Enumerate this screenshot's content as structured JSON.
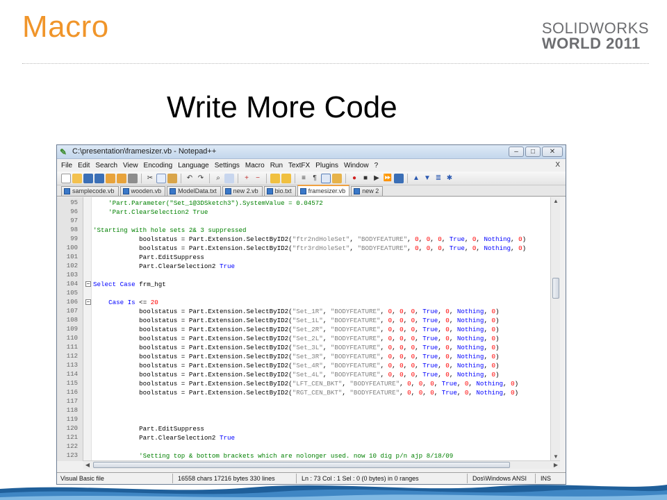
{
  "slide": {
    "title": "Macro",
    "brand_line1": "SOLIDWORKS",
    "brand_line2": "WORLD 2011",
    "heading": "Write More Code"
  },
  "window": {
    "title": "C:\\presentation\\framesizer.vb - Notepad++",
    "buttons": {
      "minimize": "–",
      "maximize": "□",
      "close": "✕"
    }
  },
  "menu": {
    "items": [
      "File",
      "Edit",
      "Search",
      "View",
      "Encoding",
      "Language",
      "Settings",
      "Macro",
      "Run",
      "TextFX",
      "Plugins",
      "Window",
      "?"
    ],
    "close_x": "X"
  },
  "tabs": [
    {
      "label": "samplecode.vb",
      "active": false
    },
    {
      "label": "wooden.vb",
      "active": false
    },
    {
      "label": "ModelData.txt",
      "active": false
    },
    {
      "label": "new 2.vb",
      "active": false
    },
    {
      "label": "bio.txt",
      "active": false
    },
    {
      "label": "framesizer.vb",
      "active": true
    },
    {
      "label": "new 2",
      "active": false
    }
  ],
  "editor": {
    "lines": [
      {
        "n": "95",
        "code": "    'Part.Parameter(\"Set_1@3DSketch3\").SystemValue = 0.04572",
        "type": "comment",
        "fold": ""
      },
      {
        "n": "96",
        "code": "    'Part.ClearSelection2 True",
        "type": "comment",
        "fold": ""
      },
      {
        "n": "97",
        "code": "",
        "type": "plain",
        "fold": ""
      },
      {
        "n": "98",
        "code": "'Starting with hole sets 2& 3 suppressed",
        "type": "comment",
        "fold": ""
      },
      {
        "n": "99",
        "code": "            boolstatus = Part.Extension.SelectByID2(\"ftr2ndHoleSet\", \"BODYFEATURE\", 0, 0, 0, True, 0, Nothing, 0)",
        "type": "call",
        "fold": ""
      },
      {
        "n": "100",
        "code": "            boolstatus = Part.Extension.SelectByID2(\"ftr3rdHoleSet\", \"BODYFEATURE\", 0, 0, 0, True, 0, Nothing, 0)",
        "type": "call",
        "fold": ""
      },
      {
        "n": "101",
        "code": "            Part.EditSuppress",
        "type": "plain",
        "fold": ""
      },
      {
        "n": "102",
        "code": "            Part.ClearSelection2 True",
        "type": "true",
        "fold": ""
      },
      {
        "n": "103",
        "code": "",
        "type": "plain",
        "fold": ""
      },
      {
        "n": "104",
        "code": "Select Case frm_hgt",
        "type": "select",
        "fold": "−"
      },
      {
        "n": "105",
        "code": "",
        "type": "plain",
        "fold": ""
      },
      {
        "n": "106",
        "code": "    Case Is <= 20",
        "type": "case",
        "fold": "−"
      },
      {
        "n": "107",
        "code": "            boolstatus = Part.Extension.SelectByID2(\"Set_1R\", \"BODYFEATURE\", 0, 0, 0, True, 0, Nothing, 0)",
        "type": "call",
        "fold": ""
      },
      {
        "n": "108",
        "code": "            boolstatus = Part.Extension.SelectByID2(\"Set_1L\", \"BODYFEATURE\", 0, 0, 0, True, 0, Nothing, 0)",
        "type": "call",
        "fold": ""
      },
      {
        "n": "109",
        "code": "            boolstatus = Part.Extension.SelectByID2(\"Set_2R\", \"BODYFEATURE\", 0, 0, 0, True, 0, Nothing, 0)",
        "type": "call",
        "fold": ""
      },
      {
        "n": "110",
        "code": "            boolstatus = Part.Extension.SelectByID2(\"Set_2L\", \"BODYFEATURE\", 0, 0, 0, True, 0, Nothing, 0)",
        "type": "call",
        "fold": ""
      },
      {
        "n": "111",
        "code": "            boolstatus = Part.Extension.SelectByID2(\"Set_3L\", \"BODYFEATURE\", 0, 0, 0, True, 0, Nothing, 0)",
        "type": "call",
        "fold": ""
      },
      {
        "n": "112",
        "code": "            boolstatus = Part.Extension.SelectByID2(\"Set_3R\", \"BODYFEATURE\", 0, 0, 0, True, 0, Nothing, 0)",
        "type": "call",
        "fold": ""
      },
      {
        "n": "113",
        "code": "            boolstatus = Part.Extension.SelectByID2(\"Set_4R\", \"BODYFEATURE\", 0, 0, 0, True, 0, Nothing, 0)",
        "type": "call",
        "fold": ""
      },
      {
        "n": "114",
        "code": "            boolstatus = Part.Extension.SelectByID2(\"Set_4L\", \"BODYFEATURE\", 0, 0, 0, True, 0, Nothing, 0)",
        "type": "call",
        "fold": ""
      },
      {
        "n": "115",
        "code": "            boolstatus = Part.Extension.SelectByID2(\"LFT_CEN_BKT\", \"BODYFEATURE\", 0, 0, 0, True, 0, Nothing, 0)",
        "type": "call",
        "fold": ""
      },
      {
        "n": "116",
        "code": "            boolstatus = Part.Extension.SelectByID2(\"RGT_CEN_BKT\", \"BODYFEATURE\", 0, 0, 0, True, 0, Nothing, 0)",
        "type": "call",
        "fold": ""
      },
      {
        "n": "117",
        "code": "",
        "type": "plain",
        "fold": ""
      },
      {
        "n": "118",
        "code": "",
        "type": "plain",
        "fold": ""
      },
      {
        "n": "119",
        "code": "",
        "type": "plain",
        "fold": ""
      },
      {
        "n": "120",
        "code": "            Part.EditSuppress",
        "type": "plain",
        "fold": ""
      },
      {
        "n": "121",
        "code": "            Part.ClearSelection2 True",
        "type": "true",
        "fold": ""
      },
      {
        "n": "122",
        "code": "",
        "type": "plain",
        "fold": ""
      },
      {
        "n": "123",
        "code": "            'Setting top & bottom brackets which are nolonger used. now 10 dig p/n ajp 8/18/09",
        "type": "comment",
        "fold": ""
      }
    ]
  },
  "status": {
    "file_type": "Visual Basic file",
    "size": "16558 chars  17216 bytes  330 lines",
    "position": "Ln : 73   Col : 1   Sel : 0 (0 bytes) in 0 ranges",
    "eol": "Dos\\Windows  ANSI",
    "mode": "INS"
  }
}
